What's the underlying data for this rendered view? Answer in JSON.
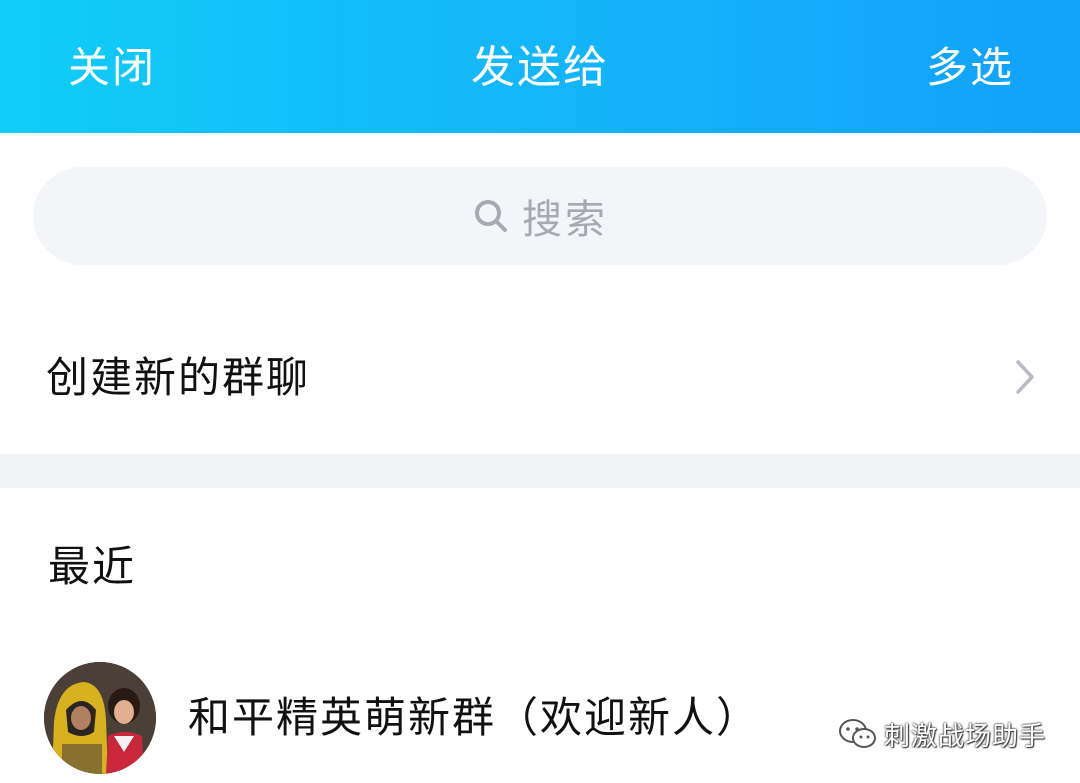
{
  "header": {
    "close_label": "关闭",
    "title": "发送给",
    "multi_select_label": "多选",
    "gradient_start": "#10cdf7",
    "gradient_end": "#12a1fb",
    "text_color": "#ffffff"
  },
  "search": {
    "icon": "search-icon",
    "placeholder": "搜索"
  },
  "create_group": {
    "label": "创建新的群聊",
    "icon": "chevron-right-icon"
  },
  "recent": {
    "section_title": "最近",
    "items": [
      {
        "name": "和平精英萌新群（欢迎新人）",
        "avatar": "group-avatar"
      }
    ]
  },
  "watermark": {
    "icon": "wechat-icon",
    "text": "刺激战场助手"
  }
}
